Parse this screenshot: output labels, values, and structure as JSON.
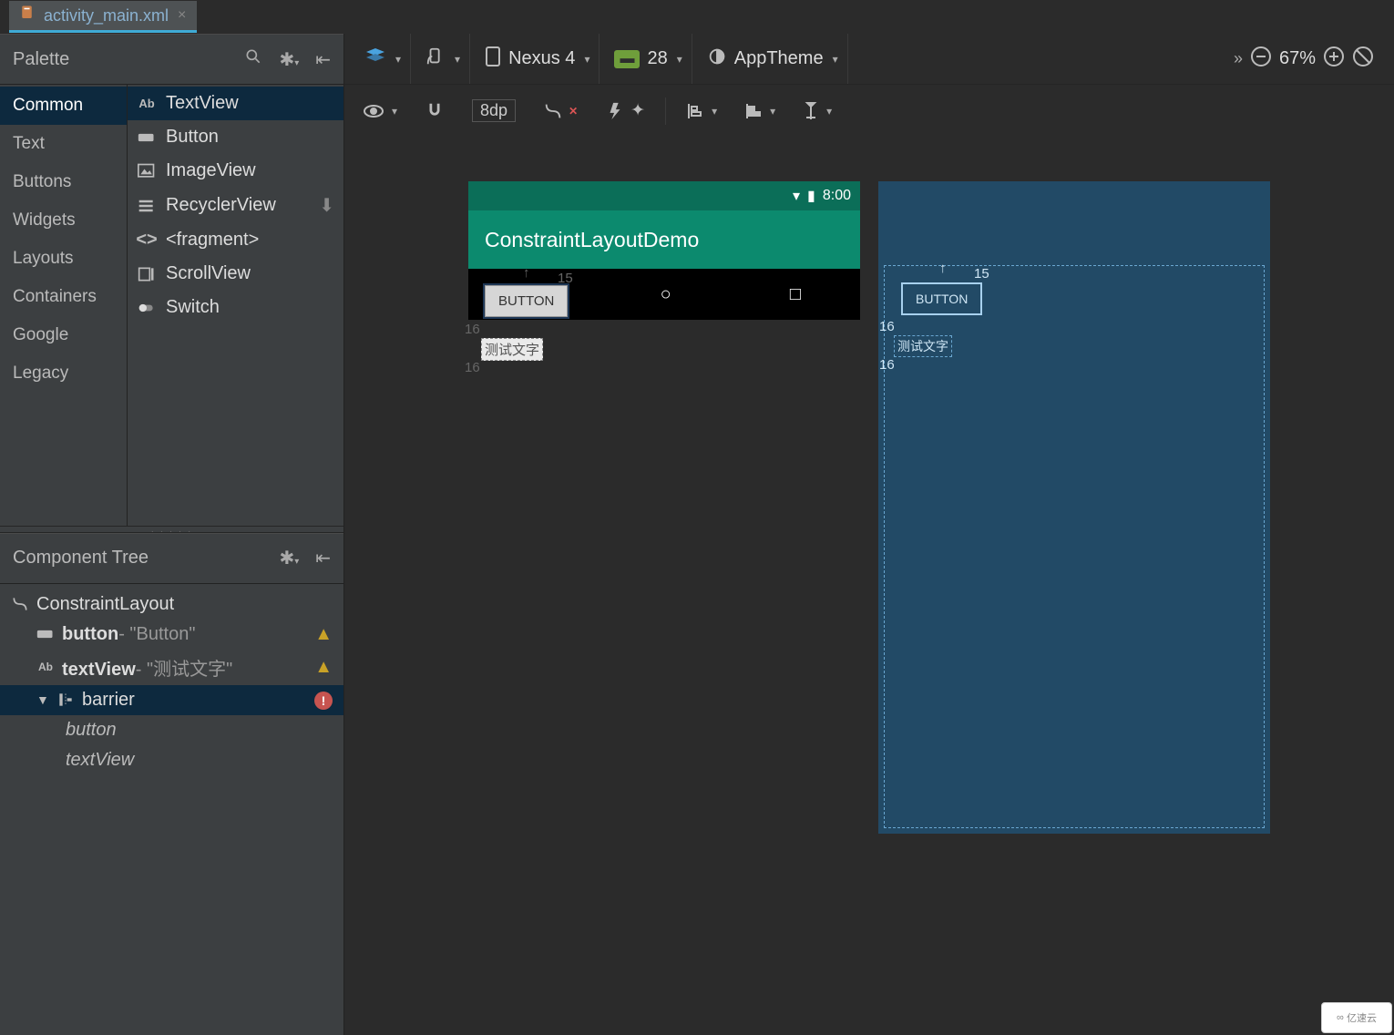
{
  "tab": {
    "filename": "activity_main.xml",
    "close": "×"
  },
  "palette": {
    "title": "Palette",
    "categories": [
      "Common",
      "Text",
      "Buttons",
      "Widgets",
      "Layouts",
      "Containers",
      "Google",
      "Legacy"
    ],
    "active_category": "Common",
    "widgets": [
      {
        "name": "TextView",
        "icon": "Ab",
        "active": true
      },
      {
        "name": "Button",
        "icon": "btn"
      },
      {
        "name": "ImageView",
        "icon": "img"
      },
      {
        "name": "RecyclerView",
        "icon": "list",
        "download": true
      },
      {
        "name": "<fragment>",
        "icon": "code"
      },
      {
        "name": "ScrollView",
        "icon": "scroll"
      },
      {
        "name": "Switch",
        "icon": "switch"
      }
    ]
  },
  "component_tree": {
    "title": "Component Tree",
    "nodes": [
      {
        "id": "root",
        "label": "ConstraintLayout",
        "icon": "constraint",
        "depth": 0
      },
      {
        "id": "button",
        "label": "button",
        "suffix": "- \"Button\"",
        "icon": "btn",
        "depth": 1,
        "warn": "warn"
      },
      {
        "id": "textView",
        "label": "textView",
        "suffix": "- \"测试文字\"",
        "icon": "Ab",
        "depth": 1,
        "warn": "warn"
      },
      {
        "id": "barrier",
        "label": "barrier",
        "icon": "barrier",
        "depth": 1,
        "warn": "error",
        "selected": true,
        "expand": true
      },
      {
        "id": "b-button",
        "label": "button",
        "italic": true,
        "depth": 2
      },
      {
        "id": "b-textView",
        "label": "textView",
        "italic": true,
        "depth": 2
      }
    ]
  },
  "toolbar": {
    "device": "Nexus 4",
    "api": "28",
    "theme": "AppTheme",
    "zoom": "67%",
    "overflow": "»"
  },
  "toolbar2": {
    "dp": "8dp"
  },
  "preview": {
    "status_time": "8:00",
    "app_title": "ConstraintLayoutDemo",
    "button_label": "BUTTON",
    "textview_label": "测试文字",
    "dim_top": "15",
    "dim_left": "16",
    "dim_left2": "16"
  },
  "watermark": "亿速云"
}
